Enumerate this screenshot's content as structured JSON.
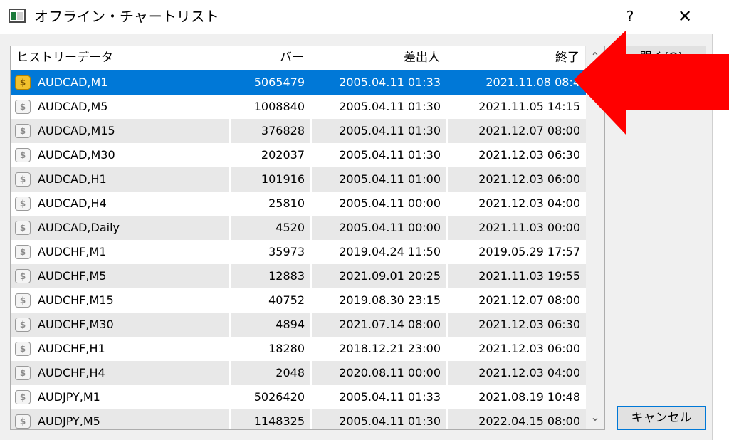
{
  "window": {
    "title": "オフライン・チャートリスト",
    "help_label": "?",
    "close_label": "✕"
  },
  "table": {
    "columns": [
      "ヒストリーデータ",
      "バー",
      "差出人",
      "終了"
    ],
    "rows": [
      {
        "name": "AUDCAD,M1",
        "bars": "5065479",
        "start": "2005.04.11 01:33",
        "end": "2021.11.08 08:4",
        "selected": true
      },
      {
        "name": "AUDCAD,M5",
        "bars": "1008840",
        "start": "2005.04.11 01:30",
        "end": "2021.11.05 14:15"
      },
      {
        "name": "AUDCAD,M15",
        "bars": "376828",
        "start": "2005.04.11 01:30",
        "end": "2021.12.07 08:00"
      },
      {
        "name": "AUDCAD,M30",
        "bars": "202037",
        "start": "2005.04.11 01:30",
        "end": "2021.12.03 06:30"
      },
      {
        "name": "AUDCAD,H1",
        "bars": "101916",
        "start": "2005.04.11 01:00",
        "end": "2021.12.03 06:00"
      },
      {
        "name": "AUDCAD,H4",
        "bars": "25810",
        "start": "2005.04.11 00:00",
        "end": "2021.12.03 04:00"
      },
      {
        "name": "AUDCAD,Daily",
        "bars": "4520",
        "start": "2005.04.11 00:00",
        "end": "2021.11.03 00:00"
      },
      {
        "name": "AUDCHF,M1",
        "bars": "35973",
        "start": "2019.04.24 11:50",
        "end": "2019.05.29 17:57"
      },
      {
        "name": "AUDCHF,M5",
        "bars": "12883",
        "start": "2021.09.01 20:25",
        "end": "2021.11.03 19:55"
      },
      {
        "name": "AUDCHF,M15",
        "bars": "40752",
        "start": "2019.08.30 23:15",
        "end": "2021.12.07 08:00"
      },
      {
        "name": "AUDCHF,M30",
        "bars": "4894",
        "start": "2021.07.14 08:00",
        "end": "2021.12.03 06:30"
      },
      {
        "name": "AUDCHF,H1",
        "bars": "18280",
        "start": "2018.12.21 23:00",
        "end": "2021.12.03 06:00"
      },
      {
        "name": "AUDCHF,H4",
        "bars": "2048",
        "start": "2020.08.11 00:00",
        "end": "2021.12.03 04:00"
      },
      {
        "name": "AUDJPY,M1",
        "bars": "5026420",
        "start": "2005.04.11 01:33",
        "end": "2021.08.19 10:48"
      },
      {
        "name": "AUDJPY,M5",
        "bars": "1148325",
        "start": "2005.04.11 01:30",
        "end": "2022.04.15 08:00"
      }
    ],
    "row_icon": "dollar-coin-icon"
  },
  "buttons": {
    "open_label": "開く(O)",
    "cancel_label": "キャンセル"
  },
  "annotation": {
    "arrow_color": "#ff0000",
    "arrow_direction": "left"
  },
  "colors": {
    "selection": "#0078d7",
    "selected_coin": "#f2c12e"
  }
}
